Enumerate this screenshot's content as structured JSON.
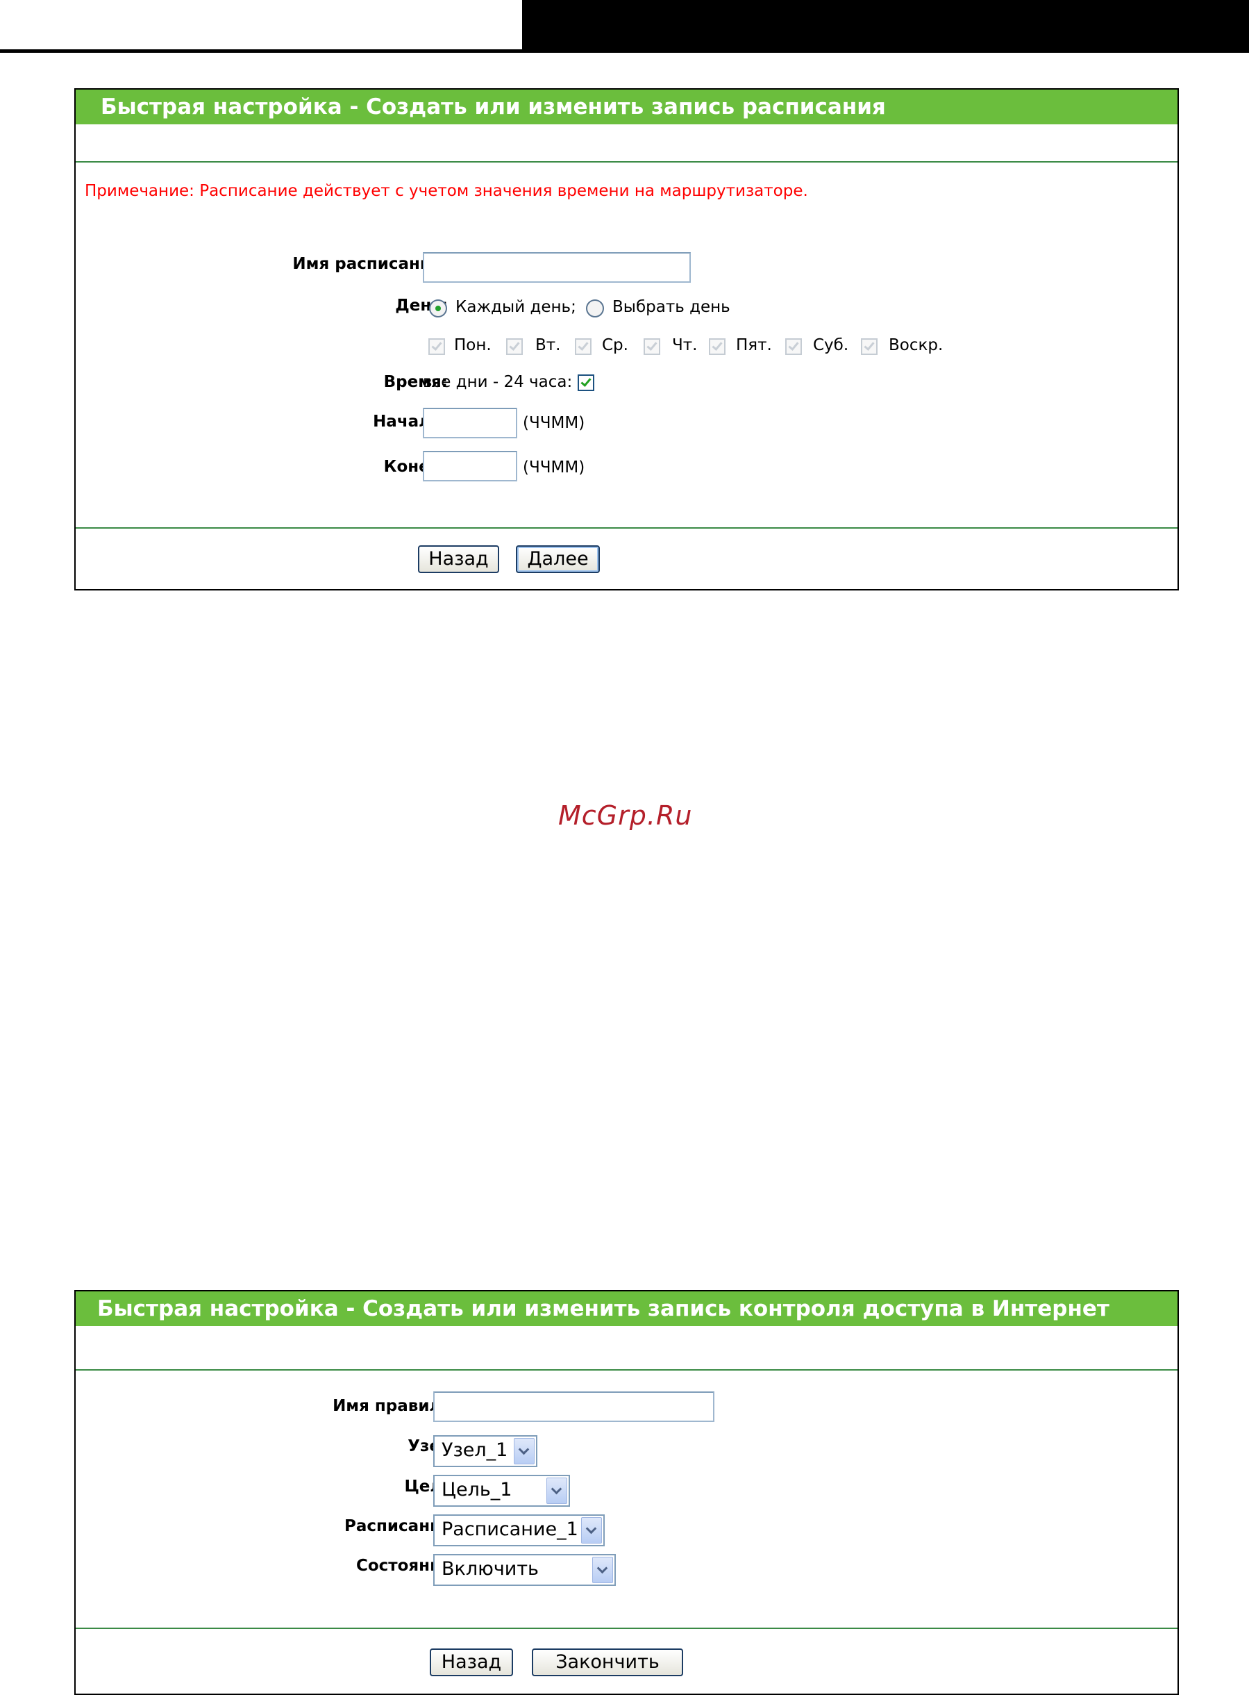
{
  "watermark": "McGrp.Ru",
  "schedule_panel": {
    "title": "Быстрая настройка - Создать или изменить запись расписания",
    "note": "Примечание: Расписание действует с учетом значения времени на маршрутизаторе.",
    "name_label": "Имя расписания:",
    "name_value": "",
    "day_label": "День:",
    "every_day_label": "Каждый день;",
    "every_day_selected": true,
    "select_day_label": "Выбрать день",
    "select_day_selected": false,
    "days": [
      {
        "label": "Пон.",
        "checked": true,
        "disabled": true
      },
      {
        "label": "Вт.",
        "checked": true,
        "disabled": true
      },
      {
        "label": "Ср.",
        "checked": true,
        "disabled": true
      },
      {
        "label": "Чт.",
        "checked": true,
        "disabled": true
      },
      {
        "label": "Пят.",
        "checked": true,
        "disabled": true
      },
      {
        "label": "Суб.",
        "checked": true,
        "disabled": true
      },
      {
        "label": "Воскр.",
        "checked": true,
        "disabled": true
      }
    ],
    "time_label": "Время:",
    "all_day_label": "все дни - 24 часа:",
    "all_day_checked": true,
    "start_label": "Начало:",
    "start_value": "",
    "start_hint": "(ЧЧММ)",
    "end_label": "Конец:",
    "end_value": "",
    "end_hint": "(ЧЧММ)",
    "back_button": "Назад",
    "next_button": "Далее"
  },
  "access_panel": {
    "title": "Быстрая настройка - Создать или изменить запись контроля доступа в Интернет",
    "rule_name_label": "Имя правила:",
    "rule_name_value": "",
    "host_label": "Узел:",
    "host_value": "Узел_1",
    "target_label": "Цель:",
    "target_value": "Цель_1",
    "schedule_label": "Расписание:",
    "schedule_value": "Расписание_1",
    "status_label": "Состояние:",
    "status_value": "Включить",
    "back_button": "Назад",
    "finish_button": "Закончить"
  }
}
